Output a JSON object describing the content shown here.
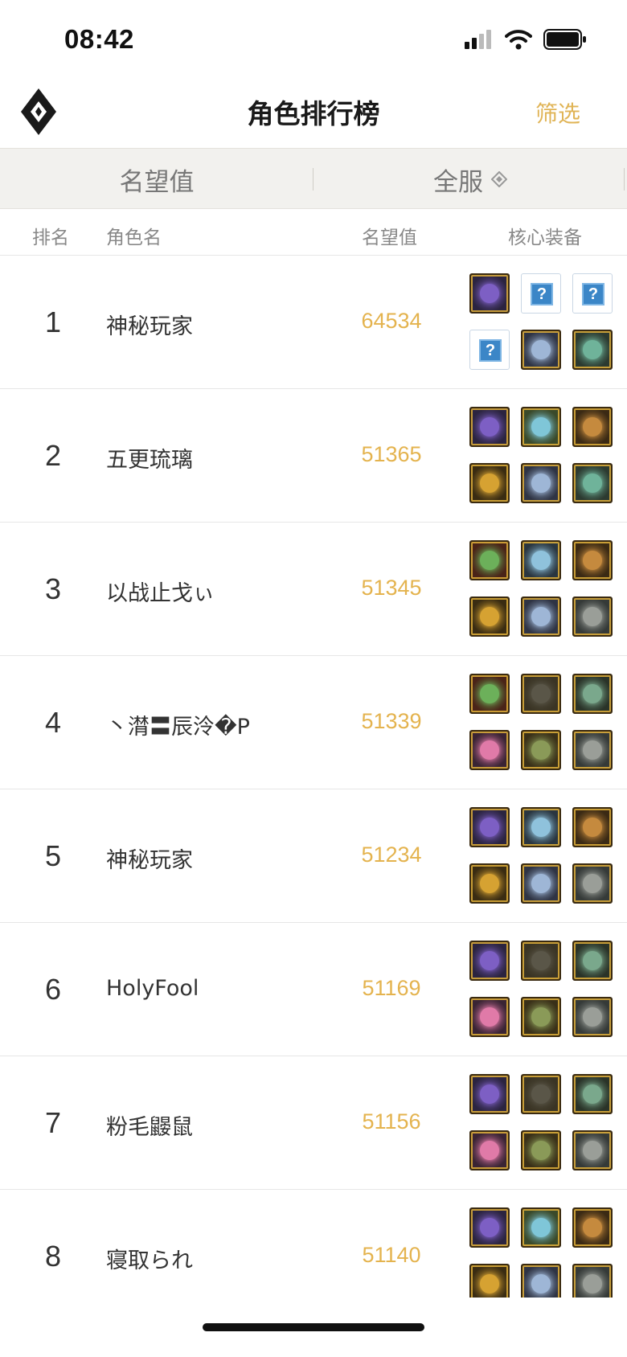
{
  "status": {
    "time": "08:42"
  },
  "nav": {
    "title": "角色排行榜",
    "filter": "筛选"
  },
  "tabs": {
    "left": "名望值",
    "right": "全服"
  },
  "columns": {
    "rank": "排名",
    "name": "角色名",
    "score": "名望值",
    "gear": "核心装备"
  },
  "colors": {
    "accent": "#e4b34e",
    "filter": "#e0b456",
    "tab_bg": "#f2f1ee"
  },
  "gear_types": {
    "blade": {
      "bg": "#2b2440",
      "core": "#7d5fc4",
      "icon": "purple-blade-icon"
    },
    "orb": {
      "bg": "#3a4a2a",
      "core": "#7fc6d8",
      "icon": "teal-orb-icon"
    },
    "atom": {
      "bg": "#3b2a14",
      "core": "#c58a3e",
      "icon": "atom-icon"
    },
    "cross": {
      "bg": "#3a2c12",
      "core": "#d6a232",
      "icon": "gold-cross-icon"
    },
    "wings": {
      "bg": "#2f3444",
      "core": "#9eb6d6",
      "icon": "silver-wings-icon"
    },
    "armor": {
      "bg": "#2c3a30",
      "core": "#6fb39a",
      "icon": "green-armor-icon"
    },
    "plant": {
      "bg": "#4a2418",
      "core": "#6cb05a",
      "icon": "plant-icon"
    },
    "disk": {
      "bg": "#2a3640",
      "core": "#8fc2dc",
      "icon": "blue-disk-icon"
    },
    "dark": {
      "bg": "#3a3424",
      "core": "#5a5648",
      "icon": "dark-claw-icon"
    },
    "jade": {
      "bg": "#2a3328",
      "core": "#7aa88c",
      "icon": "jade-ring-icon"
    },
    "pink": {
      "bg": "#3a2434",
      "core": "#e07aa8",
      "icon": "pink-gem-icon"
    },
    "cloak": {
      "bg": "#3a3018",
      "core": "#8a9a58",
      "icon": "cloak-icon"
    },
    "golem": {
      "bg": "#353a38",
      "core": "#9a9e98",
      "icon": "stone-golem-icon"
    },
    "unknown": {
      "bg": "#ffffff",
      "core": "#3b86c7",
      "icon": "question-icon",
      "label": "?"
    }
  },
  "rankings": [
    {
      "rank": "1",
      "name": "神秘玩家",
      "score": "64534",
      "gear": [
        "blade",
        "unknown",
        "unknown",
        "unknown",
        "wings",
        "armor"
      ]
    },
    {
      "rank": "2",
      "name": "五更琉璃",
      "score": "51365",
      "gear": [
        "blade",
        "orb",
        "atom",
        "cross",
        "wings",
        "armor"
      ]
    },
    {
      "rank": "3",
      "name": "以战止戈ぃ",
      "score": "51345",
      "gear": [
        "plant",
        "disk",
        "atom",
        "cross",
        "wings",
        "golem"
      ]
    },
    {
      "rank": "4",
      "name": "丶潸〓辰泠�P",
      "score": "51339",
      "gear": [
        "plant",
        "dark",
        "jade",
        "pink",
        "cloak",
        "golem"
      ]
    },
    {
      "rank": "5",
      "name": "神秘玩家",
      "score": "51234",
      "gear": [
        "blade",
        "disk",
        "atom",
        "cross",
        "wings",
        "golem"
      ]
    },
    {
      "rank": "6",
      "name": "HolyFool",
      "score": "51169",
      "gear": [
        "blade",
        "dark",
        "jade",
        "pink",
        "cloak",
        "golem"
      ]
    },
    {
      "rank": "7",
      "name": "粉毛鼹鼠",
      "score": "51156",
      "gear": [
        "blade",
        "dark",
        "jade",
        "pink",
        "cloak",
        "golem"
      ]
    },
    {
      "rank": "8",
      "name": "寝取られ",
      "score": "51140",
      "gear": [
        "blade",
        "orb",
        "atom",
        "cross",
        "wings",
        "golem"
      ]
    }
  ]
}
